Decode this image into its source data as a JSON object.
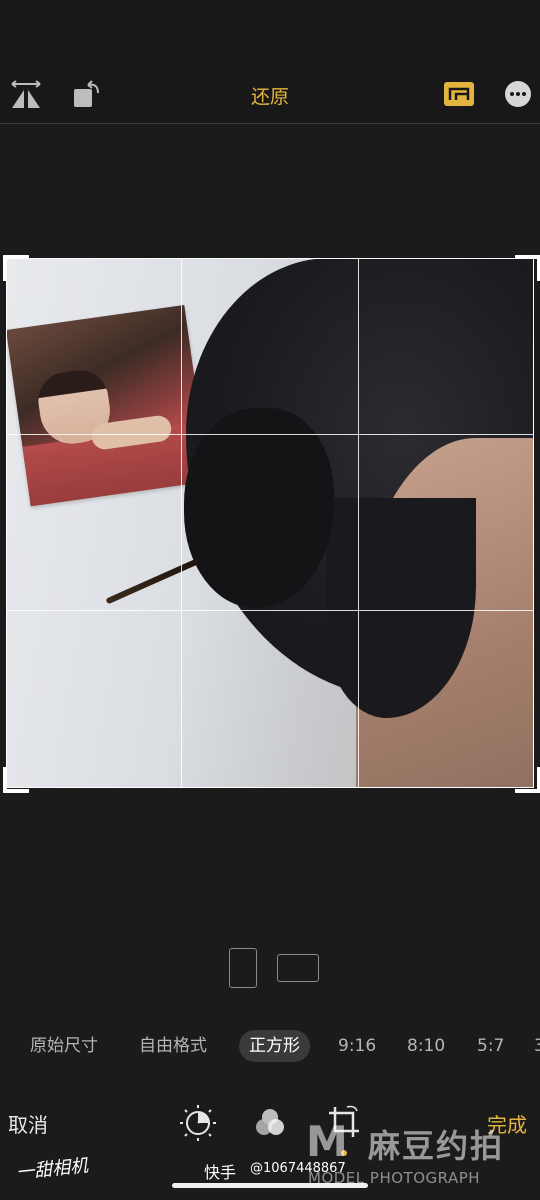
{
  "toolbar": {
    "flip_icon": "flip-horizontal-icon",
    "rotate_icon": "rotate-icon",
    "reset_label": "还原",
    "aspect_icon": "aspect-ratio-icon",
    "more_icon": "more-icon",
    "accent_color": "#e4b53e"
  },
  "orientation": {
    "portrait_icon": "portrait-orientation-icon",
    "landscape_icon": "landscape-orientation-icon"
  },
  "ratios": [
    {
      "label": "原始尺寸",
      "active": false
    },
    {
      "label": "自由格式",
      "active": false
    },
    {
      "label": "正方形",
      "active": true
    },
    {
      "label": "9:16",
      "active": false
    },
    {
      "label": "8:10",
      "active": false
    },
    {
      "label": "5:7",
      "active": false
    },
    {
      "label": "3",
      "active": false
    }
  ],
  "bottom": {
    "cancel_label": "取消",
    "done_label": "完成",
    "tools": [
      "adjust-icon",
      "filter-icon",
      "crop-icon"
    ]
  },
  "watermarks": {
    "left": "一甜相机",
    "kuaishou": "快手",
    "user_id": "@1067448867",
    "brand_logo": "M",
    "brand_cn": "麻豆约拍",
    "brand_en": "MODEL PHOTOGRAPH"
  }
}
